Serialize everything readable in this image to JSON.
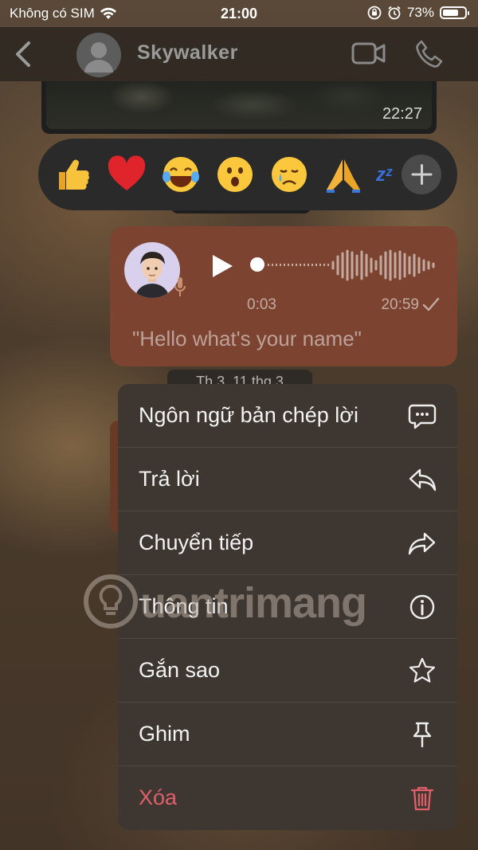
{
  "status_bar": {
    "carrier": "Không có SIM",
    "time": "21:00",
    "battery": "73%",
    "battery_level": 0.73
  },
  "header": {
    "contact_name": "Skywalker"
  },
  "image_message": {
    "time": "22:27"
  },
  "reactions": {
    "items": [
      "👍",
      "❤️",
      "😂",
      "😮",
      "😢",
      "🙏"
    ],
    "sleep_glyph": "zᶻ"
  },
  "voice_message": {
    "duration": "0:03",
    "time": "20:59",
    "transcript": "\"Hello what's your name\""
  },
  "date_pill": {
    "label": "Th 3, 11 thg 3"
  },
  "context_menu": {
    "items": [
      {
        "label": "Ngôn ngữ bản chép lời",
        "icon": "speech-bubble-icon"
      },
      {
        "label": "Trả lời",
        "icon": "reply-icon"
      },
      {
        "label": "Chuyển tiếp",
        "icon": "forward-icon"
      },
      {
        "label": "Thông tin",
        "icon": "info-icon"
      },
      {
        "label": "Gắn sao",
        "icon": "star-icon"
      },
      {
        "label": "Ghim",
        "icon": "pin-icon"
      },
      {
        "label": "Xóa",
        "icon": "trash-icon"
      }
    ]
  },
  "watermark": {
    "text": "uantrimang"
  },
  "colors": {
    "voice_bubble": "#7b4330",
    "menu_bg": "#3e3630",
    "danger": "#e0606a"
  }
}
